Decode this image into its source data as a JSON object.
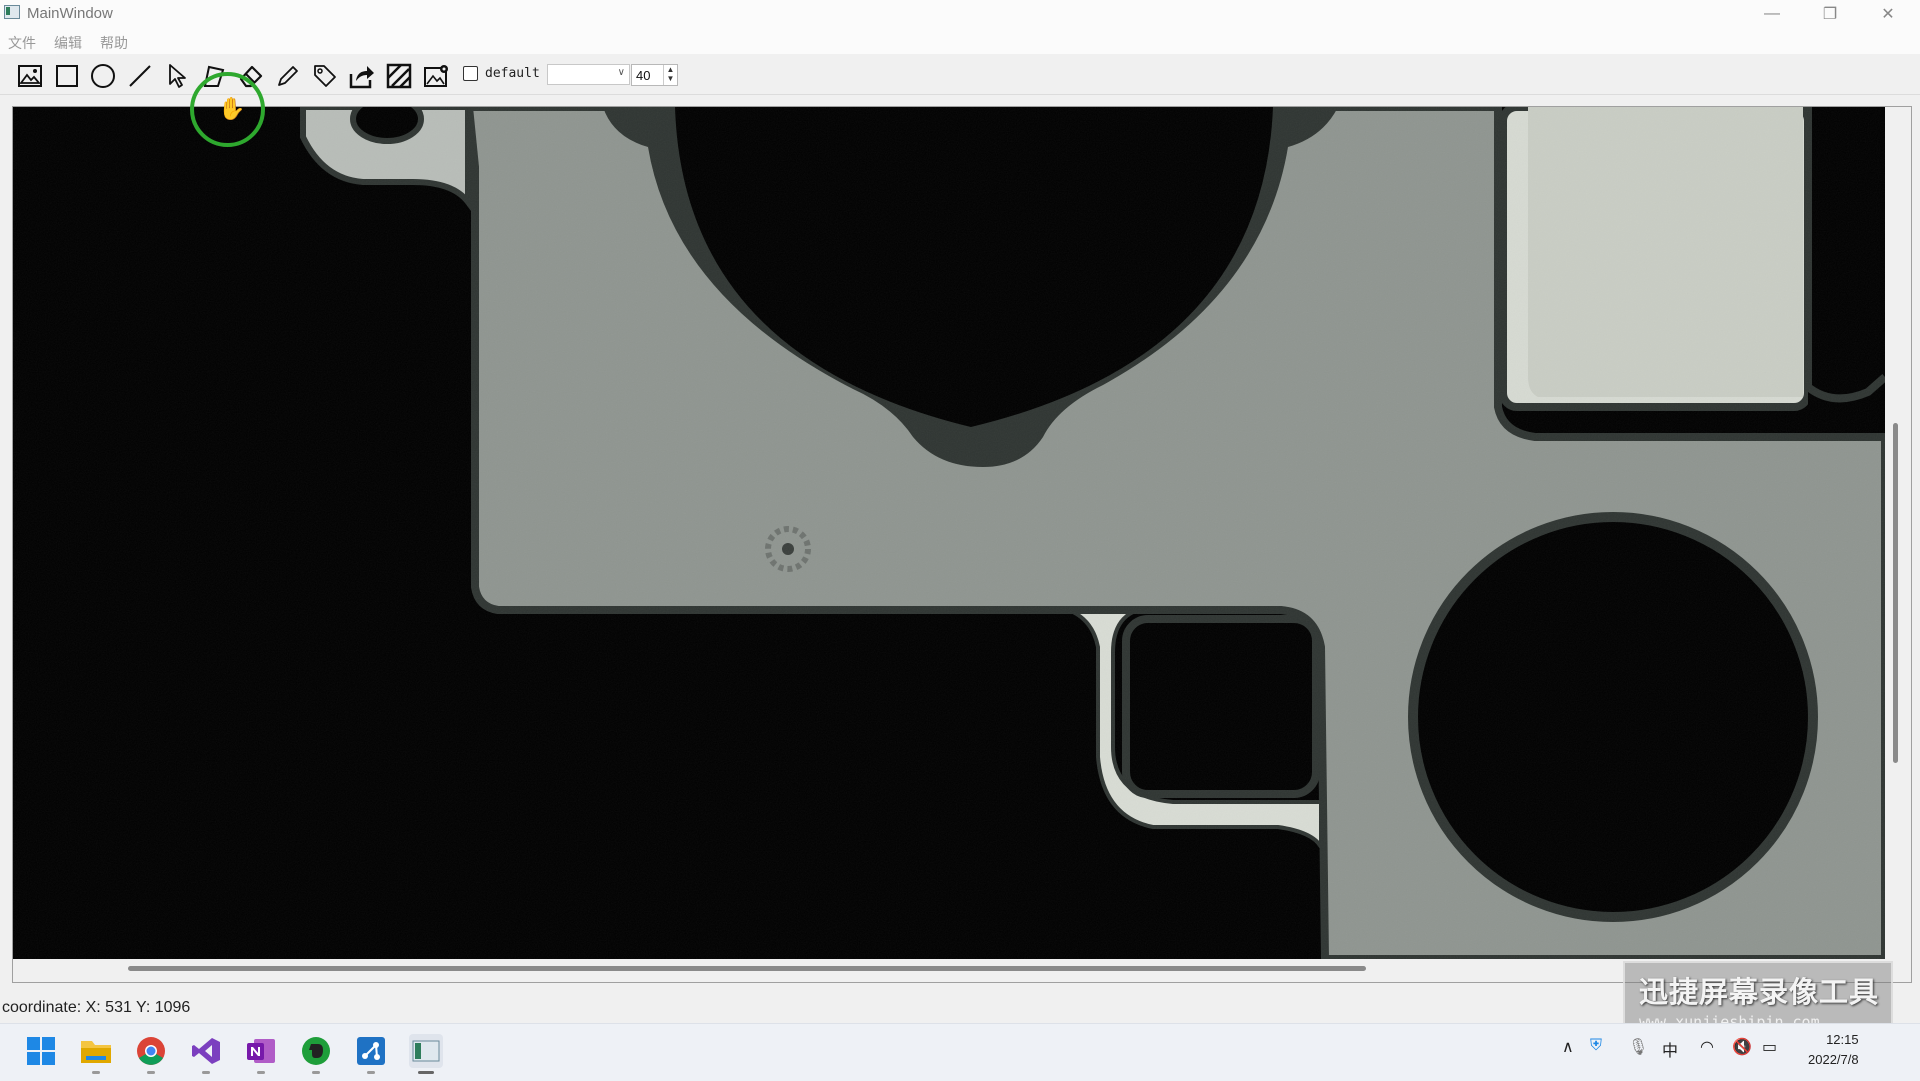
{
  "window": {
    "title": "MainWindow",
    "controls": [
      "minimize",
      "restore",
      "close"
    ]
  },
  "menu": {
    "items": [
      "文件",
      "编辑",
      "帮助"
    ]
  },
  "toolbar": {
    "tools": [
      {
        "name": "open-image-icon"
      },
      {
        "name": "rectangle-tool-icon"
      },
      {
        "name": "ellipse-tool-icon"
      },
      {
        "name": "line-tool-icon"
      },
      {
        "name": "select-pointer-icon"
      },
      {
        "name": "polygon-tool-icon"
      },
      {
        "name": "eraser-icon"
      },
      {
        "name": "pencil-icon"
      },
      {
        "name": "tag-icon"
      },
      {
        "name": "export-share-icon"
      },
      {
        "name": "hatch-fill-icon"
      },
      {
        "name": "image-settings-icon"
      }
    ],
    "checkbox_label": "default",
    "checkbox_checked": false,
    "dropdown_value": "",
    "spin_value": "40"
  },
  "status": {
    "coordinate": "coordinate: X: 531 Y: 1096"
  },
  "watermark": {
    "line1": "迅捷屏幕录像工具",
    "line2": "www.xunjieshipin.com"
  },
  "taskbar": {
    "apps": [
      "windows-start-icon",
      "file-explorer-icon",
      "chrome-icon",
      "visual-studio-icon",
      "onenote-icon",
      "evernote-icon",
      "network-app-icon",
      "mainwindow-app-icon"
    ],
    "tray_ime": "中",
    "clock_time": "12:15",
    "clock_date": "2022/7/8"
  },
  "colors": {
    "part_gray": "#8f9590",
    "part_edge": "#2f3532",
    "cursor_ring": "#2ea82e"
  }
}
